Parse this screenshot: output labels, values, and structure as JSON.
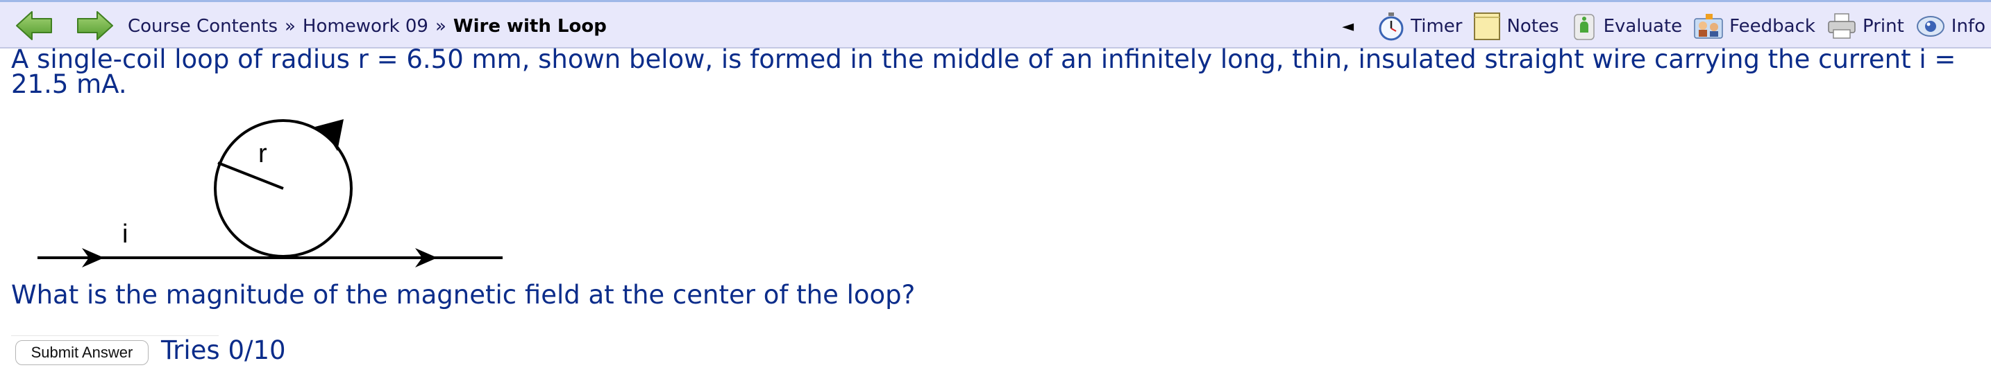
{
  "nav": {
    "breadcrumb": {
      "course": "Course Contents",
      "separator_1": "»",
      "homework": "Homework 09",
      "separator_2": "»",
      "current": "Wire with Loop"
    },
    "tools": {
      "collapse": "◄",
      "timer": "Timer",
      "notes": "Notes",
      "evaluate": "Evaluate",
      "feedback": "Feedback",
      "print": "Print",
      "info": "Info"
    }
  },
  "problem": {
    "statement": "A single-coil loop of radius r = 6.50 mm, shown below, is formed in the middle of an infinitely long, thin, insulated straight wire carrying the current i = 21.5 mA.",
    "figure": {
      "radius_label": "r",
      "current_label": "i"
    },
    "question": "What is the magnitude of the magnetic field at the center of the loop?"
  },
  "answer": {
    "value": "",
    "submit_label": "Submit Answer",
    "tries": "Tries 0/10"
  },
  "colors": {
    "nav_background": "#e8e8fb",
    "text_blue": "#0b2c8a",
    "arrow_green": "#6cae3a"
  }
}
